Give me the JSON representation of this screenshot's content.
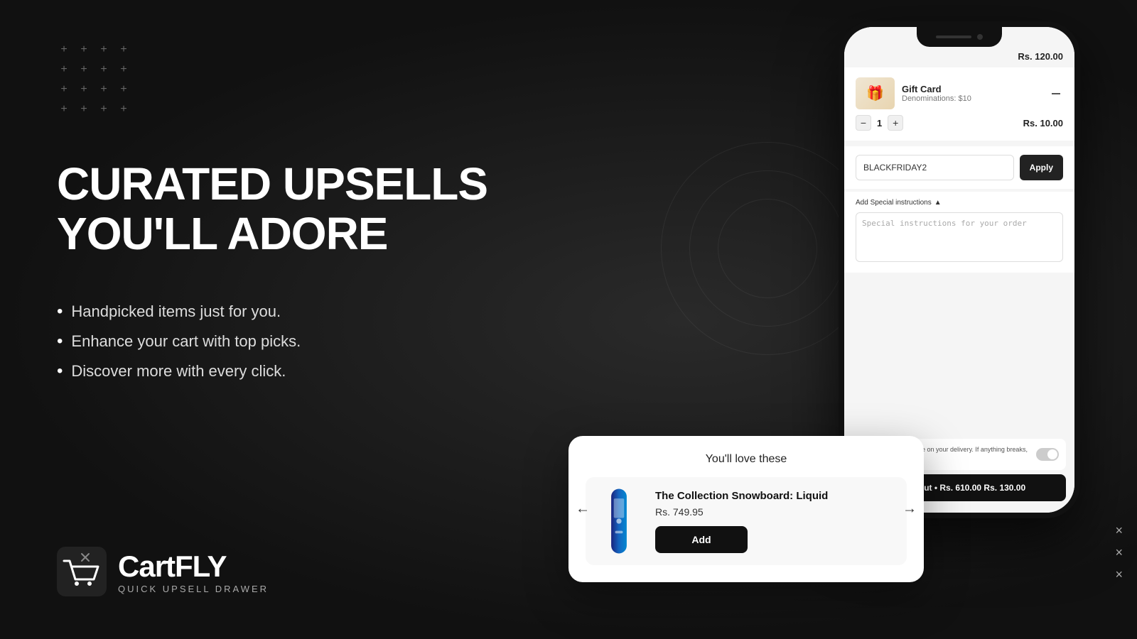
{
  "page": {
    "background_color": "#1a1a1a"
  },
  "left": {
    "plus_grid": [
      "+ + + +",
      "+ + + +",
      "+ + + +",
      "+ + + +"
    ],
    "headline_line1": "CURATED UPSELLS",
    "headline_line2": "YOU'LL ADORE",
    "bullets": [
      "Handpicked items just for you.",
      "Enhance your cart with top picks.",
      "Discover more with every click."
    ],
    "logo_name": "CartFLY",
    "logo_tagline": "QUICK UPSELL DRAWER"
  },
  "phone": {
    "price_top": "Rs. 120.00",
    "cart_item": {
      "name": "Gift Card",
      "denomination": "Denominations: $10",
      "qty": "1",
      "price": "Rs. 10.00",
      "image_emoji": "🎁"
    },
    "coupon": {
      "code": "BLACKFRIDAY2",
      "apply_label": "Apply"
    },
    "special_instructions": {
      "label": "Add Special instructions",
      "placeholder": "Special instructions for your order",
      "textarea_text": "Special instructions for your order"
    },
    "insurance": {
      "text": "Get insurance on your delivery. If anything breaks, it is up to us."
    },
    "checkout_label": "Checkout • Rs. 610.00 Rs. 130.00"
  },
  "upsell": {
    "title": "You'll love these",
    "product": {
      "name": "The Collection Snowboard: Liquid",
      "price": "Rs. 749.95",
      "add_label": "Add"
    },
    "nav_left": "←",
    "nav_right": "→"
  },
  "x_marks": [
    "×",
    "×",
    "×"
  ]
}
